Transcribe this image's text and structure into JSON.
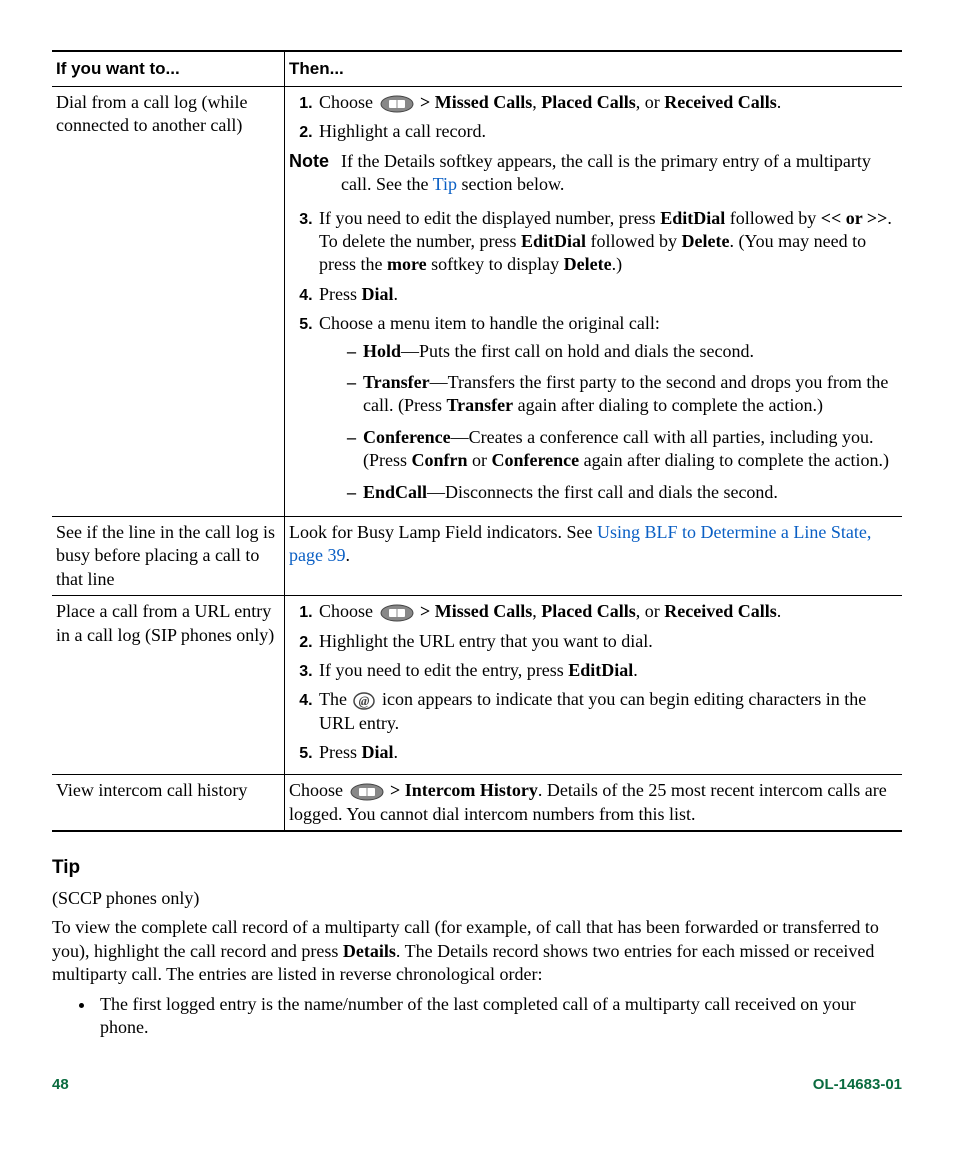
{
  "table": {
    "header_left": "If you want to...",
    "header_right": "Then...",
    "row1": {
      "left": "Dial from a call log (while connected to another call)",
      "step1_a": "Choose ",
      "step1_b": " > ",
      "step1_missed": "Missed Calls",
      "step1_c": ", ",
      "step1_placed": "Placed Calls",
      "step1_d": ", or ",
      "step1_received": "Received Calls",
      "step1_e": ".",
      "step2": "Highlight a call record.",
      "note_label": "Note",
      "note_a": "If the Details softkey appears, the call is the primary entry of a multiparty call. See the ",
      "note_link": "Tip",
      "note_b": " section below.",
      "step3_a": "If you need to edit the displayed number, press ",
      "step3_editdial": "EditDial",
      "step3_b": " followed by ",
      "step3_arrows": "<< or >>",
      "step3_c": ". To delete the number, press ",
      "step3_d": " followed by ",
      "step3_delete": "Delete",
      "step3_e": ". (You may need to press the ",
      "step3_more": "more",
      "step3_f": " softkey to display ",
      "step3_g": ".)",
      "step4_a": "Press ",
      "step4_dial": "Dial",
      "step4_b": ".",
      "step5": "Choose a menu item to handle the original call:",
      "opt_hold_label": "Hold",
      "opt_hold_text": "—Puts the first call on hold and dials the second.",
      "opt_transfer_label": "Transfer",
      "opt_transfer_text_a": "—Transfers the first party to the second and drops you from the call. (Press ",
      "opt_transfer_text_b": " again after dialing to complete the action.)",
      "opt_conf_label": "Conference",
      "opt_conf_text_a": "—Creates a conference call with all parties, including you. (Press ",
      "opt_conf_confrn": "Confrn",
      "opt_conf_or": " or ",
      "opt_conf_text_b": " again after dialing to complete the action.)",
      "opt_end_label": "EndCall",
      "opt_end_text": "—Disconnects the first call and dials the second."
    },
    "row2": {
      "left": "See if the line in the call log is busy before placing a call to that line",
      "right_a": "Look for Busy Lamp Field indicators. See ",
      "right_link": "Using BLF to Determine a Line State, page 39",
      "right_b": "."
    },
    "row3": {
      "left": "Place a call from a URL entry in a call log (SIP phones only)",
      "step1_a": "Choose ",
      "step1_b": " > ",
      "step1_missed": "Missed Calls",
      "step1_c": ", ",
      "step1_placed": "Placed Calls",
      "step1_d": ", or ",
      "step1_received": "Received Calls",
      "step1_e": ".",
      "step2": "Highlight the URL entry that you want to dial.",
      "step3_a": "If you need to edit the entry, press ",
      "step3_editdial": "EditDial",
      "step3_b": ".",
      "step4_a": "The ",
      "step4_b": " icon appears to indicate that you can begin editing characters in the URL entry.",
      "step5_a": "Press ",
      "step5_dial": "Dial",
      "step5_b": "."
    },
    "row4": {
      "left": "View intercom call history",
      "right_a": "Choose ",
      "right_b": " > ",
      "right_label": "Intercom History",
      "right_c": ". Details of the 25 most recent intercom calls are logged. You cannot dial intercom numbers from this list."
    }
  },
  "tip": {
    "heading": "Tip",
    "sccp": "(SCCP phones only)",
    "para_a": "To view the complete call record of a multiparty call (for example, of call that has been forwarded or transferred to you), highlight the call record and press ",
    "para_details": "Details",
    "para_b": ". The Details record shows two entries for each missed or received multiparty call. The entries are listed in reverse chronological order:",
    "bullet1": "The first logged entry is the name/number of the last completed call of a multiparty call received on your phone."
  },
  "footer": {
    "page": "48",
    "docid": "OL-14683-01"
  }
}
